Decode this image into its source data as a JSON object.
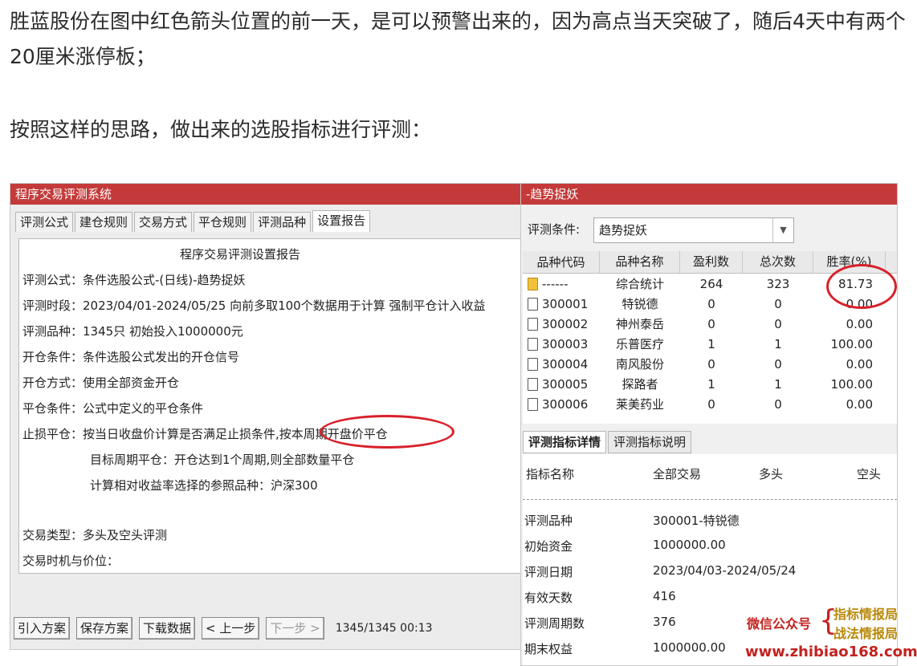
{
  "article": {
    "para1": "胜蓝股份在图中红色箭头位置的前一天，是可以预警出来的，因为高点当天突破了，随后4天中有两个20厘米涨停板；",
    "para2": "按照这样的思路，做出来的选股指标进行评测："
  },
  "left_window": {
    "title": "程序交易评测系统",
    "tabs": [
      "评测公式",
      "建仓规则",
      "交易方式",
      "平仓规则",
      "评测品种",
      "设置报告"
    ],
    "active_tab": "设置报告",
    "report_title": "程序交易评测设置报告",
    "lines": [
      "评测公式：条件选股公式-(日线)-趋势捉妖",
      "评测时段：2023/04/01-2024/05/25 向前多取100个数据用于计算 强制平仓计入收益",
      "评测品种：1345只 初始投入1000000元",
      "开仓条件：条件选股公式发出的开仓信号",
      "开仓方式：使用全部资金开仓",
      "平仓条件：公式中定义的平仓条件",
      "止损平仓：按当日收盘价计算是否满足止损条件,按本周期开盘价平仓"
    ],
    "indent_lines": [
      "目标周期平仓：开仓达到1个周期,则全部数量平仓",
      "计算相对收益率选择的参照品种：沪深300"
    ],
    "trade_type": "交易类型：多头及空头评测",
    "trade_timing": "交易时机与价位：",
    "buttons": {
      "import": "引入方案",
      "save": "保存方案",
      "download": "下载数据",
      "prev": "< 上一步",
      "next": "下一步 >"
    },
    "status": "1345/1345  00:13"
  },
  "right_window": {
    "title": "-趋势捉妖",
    "condition_label": "评测条件:",
    "condition_value": "趋势捉妖",
    "columns": [
      "品种代码",
      "品种名称",
      "盈利数",
      "总次数",
      "胜率(%)"
    ],
    "rows": [
      {
        "code": "------",
        "name": "综合统计",
        "profit": "264",
        "total": "323",
        "rate": "81.73",
        "folder": true
      },
      {
        "code": "300001",
        "name": "特锐德",
        "profit": "0",
        "total": "0",
        "rate": "0.00"
      },
      {
        "code": "300002",
        "name": "神州泰岳",
        "profit": "0",
        "total": "0",
        "rate": "0.00"
      },
      {
        "code": "300003",
        "name": "乐普医疗",
        "profit": "1",
        "total": "1",
        "rate": "100.00"
      },
      {
        "code": "300004",
        "name": "南风股份",
        "profit": "0",
        "total": "0",
        "rate": "0.00"
      },
      {
        "code": "300005",
        "name": "探路者",
        "profit": "1",
        "total": "1",
        "rate": "100.00"
      },
      {
        "code": "300006",
        "name": "莱美药业",
        "profit": "0",
        "total": "0",
        "rate": "0.00"
      }
    ],
    "detail_tabs": [
      "评测指标详情",
      "评测指标说明"
    ],
    "detail_headers": [
      "指标名称",
      "全部交易",
      "多头",
      "空头"
    ],
    "detail_rows": [
      {
        "label": "评测品种",
        "value": "300001-特锐德"
      },
      {
        "label": "初始资金",
        "value": "1000000.00"
      },
      {
        "label": "评测日期",
        "value": "2023/04/03-2024/05/24"
      },
      {
        "label": "有效天数",
        "value": "416"
      },
      {
        "label": "评测周期数",
        "value": "376"
      },
      {
        "label": "期末权益",
        "value": "1000000.00"
      }
    ]
  },
  "watermark": {
    "label": "微信公众号",
    "line1": "指标情报局",
    "line2": "战法情报局",
    "url": "www.zhibiao168.com"
  },
  "colors": {
    "title_bar": "#c43a3a",
    "annotation_red": "#d8202a",
    "watermark_gold": "#b8890a"
  }
}
